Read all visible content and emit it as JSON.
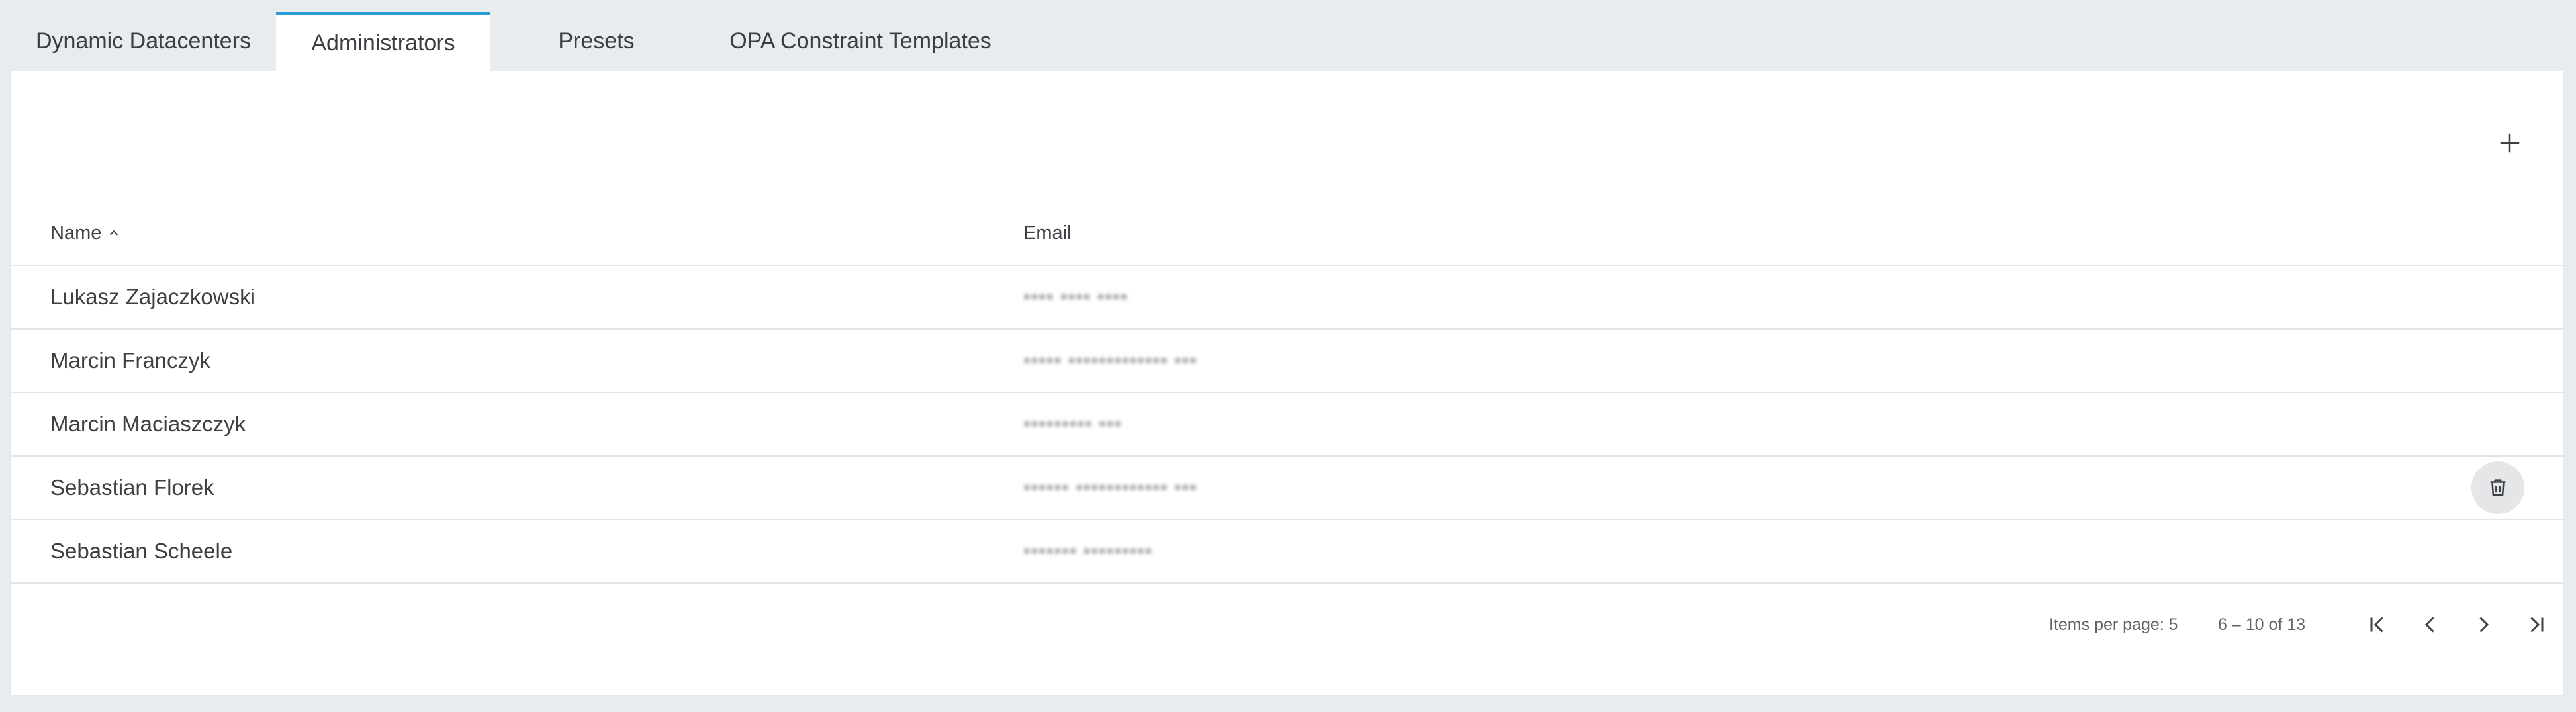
{
  "tabs": [
    {
      "label": "Dynamic Datacenters",
      "active": false
    },
    {
      "label": "Administrators",
      "active": true
    },
    {
      "label": "Presets",
      "active": false
    },
    {
      "label": "OPA Constraint Templates",
      "active": false
    }
  ],
  "colors": {
    "active_tab_accent": "#2d9bd7",
    "background": "#e9ecee",
    "card": "#ffffff"
  },
  "toolbar": {
    "add_icon": "plus-icon"
  },
  "table": {
    "columns": [
      {
        "label": "Name",
        "sort": "ascending"
      },
      {
        "label": "Email"
      }
    ],
    "rows": [
      {
        "name": "Lukasz Zajaczkowski",
        "email": "▪▪▪▪ ▪▪▪▪ ▪▪▪▪"
      },
      {
        "name": "Marcin Franczyk",
        "email": "▪▪▪▪▪ ▪▪▪▪▪▪▪▪▪▪▪▪▪ ▪▪▪"
      },
      {
        "name": "Marcin Maciaszczyk",
        "email": "▪▪▪▪▪▪▪▪▪ ▪▪▪"
      },
      {
        "name": "Sebastian Florek",
        "email": "▪▪▪▪▪▪ ▪▪▪▪▪▪▪▪▪▪▪▪ ▪▪▪",
        "show_delete": true
      },
      {
        "name": "Sebastian Scheele",
        "email": "▪▪▪▪▪▪▪ ▪▪▪▪▪▪▪▪▪"
      }
    ]
  },
  "paginator": {
    "items_per_page_label": "Items per page: 5",
    "range_label": "6 – 10 of 13"
  }
}
